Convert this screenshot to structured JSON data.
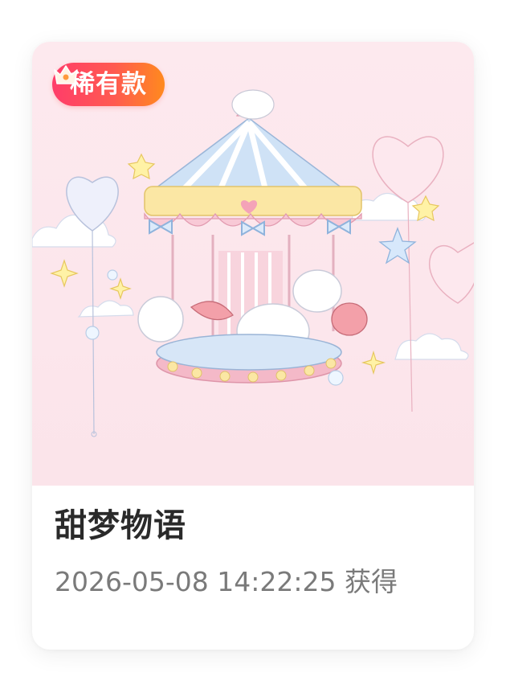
{
  "badge": {
    "label": "稀有款",
    "icon": "crown-icon",
    "gradient_colors": [
      "#ff3d6a",
      "#ff8a1e"
    ]
  },
  "item": {
    "title": "甜梦物语",
    "acquired_text": "2026-05-08 14:22:25 获得"
  },
  "artwork": {
    "subject": "pastel carousel illustration",
    "background_color": "#fde9ee"
  }
}
